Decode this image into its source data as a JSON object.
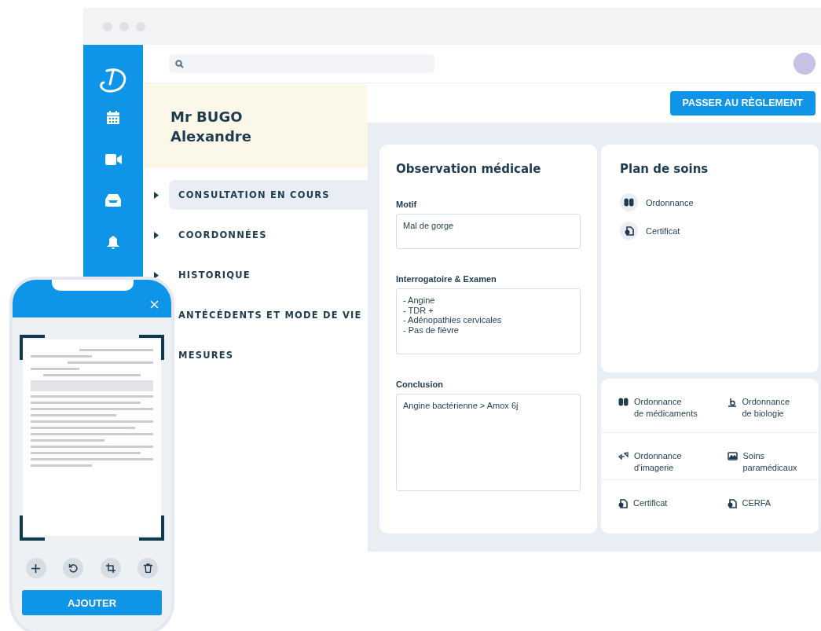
{
  "patient": {
    "name_lines": [
      "Mr BUGO",
      "Alexandre"
    ]
  },
  "nav": [
    {
      "label": "CONSULTATION EN COURS",
      "selected": true
    },
    {
      "label": "COORDONNÉES",
      "selected": false
    },
    {
      "label": "HISTORIQUE",
      "selected": false
    },
    {
      "label": "ANTÉCÉDENTS ET MODE DE VIE",
      "selected": false
    },
    {
      "label": "MESURES",
      "selected": false
    }
  ],
  "toolbar": {
    "button": "PASSER AU RÈGLEMENT"
  },
  "observation": {
    "title": "Observation médicale",
    "fields": [
      {
        "label": "Motif",
        "value": "Mal de gorge"
      },
      {
        "label": "Interrogatoire & Examen",
        "value": "- Angine\n- TDR +\n- Adénopathies cervicales\n- Pas de fièvre"
      },
      {
        "label": "Conclusion",
        "value": "Angine bactérienne > Amox 6j"
      }
    ]
  },
  "care_plan": {
    "title": "Plan de soins",
    "items": [
      {
        "label": "Ordonnance",
        "kind": "medication"
      },
      {
        "label": "Certificat",
        "kind": "certificate"
      }
    ]
  },
  "shortcuts": [
    {
      "label": "Ordonnance\nde médicaments",
      "kind": "medication"
    },
    {
      "label": "Ordonnance\nde biologie",
      "kind": "biology"
    },
    {
      "label": "Ordonnance\nd'imagerie",
      "kind": "imaging"
    },
    {
      "label": "Soins\nparamédicaux",
      "kind": "picture"
    },
    {
      "label": "Certificat",
      "kind": "certificate"
    },
    {
      "label": "CERFA",
      "kind": "certificate"
    }
  ],
  "phone": {
    "button": "AJOUTER"
  }
}
